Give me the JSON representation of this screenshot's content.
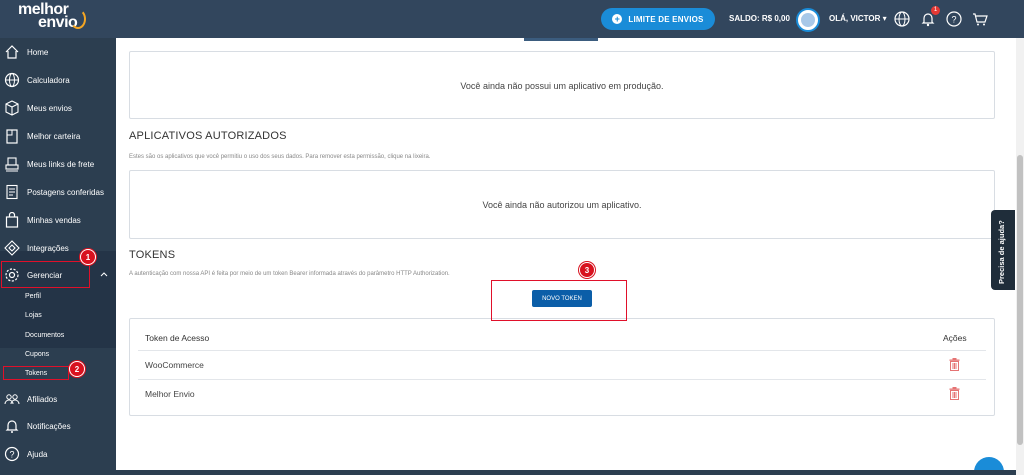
{
  "header": {
    "logo_line1": "melhor",
    "logo_line2": "envio",
    "limit_button": "LIMITE DE ENVIOS",
    "saldo": "SALDO: R$ 0,00",
    "greeting": "OLÁ, VICTOR",
    "notification_count": "1"
  },
  "sidebar": {
    "items": [
      {
        "label": "Home",
        "icon": "home-icon"
      },
      {
        "label": "Calculadora",
        "icon": "globe-icon"
      },
      {
        "label": "Meus envios",
        "icon": "box-icon"
      },
      {
        "label": "Melhor carteira",
        "icon": "wallet-icon"
      },
      {
        "label": "Meus links de frete",
        "icon": "truck-icon"
      },
      {
        "label": "Postagens conferidas",
        "icon": "receipt-icon"
      },
      {
        "label": "Minhas vendas",
        "icon": "bag-icon"
      },
      {
        "label": "Integrações",
        "icon": "puzzle-icon"
      },
      {
        "label": "Gerenciar",
        "icon": "gear-icon"
      },
      {
        "label": "Afiliados",
        "icon": "users-icon"
      },
      {
        "label": "Notificações",
        "icon": "bell-icon"
      },
      {
        "label": "Ajuda",
        "icon": "help-icon"
      }
    ],
    "subitems": [
      "Perfil",
      "Lojas",
      "Documentos",
      "Cupons",
      "Tokens"
    ]
  },
  "main": {
    "production_empty": "Você ainda não possui um aplicativo em produção.",
    "authorized_title": "APLICATIVOS AUTORIZADOS",
    "authorized_desc": "Estes são os aplicativos que você permitiu o uso dos seus dados. Para remover esta permissão, clique na lixeira.",
    "authorized_empty": "Você ainda não autorizou um aplicativo.",
    "tokens_title": "TOKENS",
    "tokens_desc": "A autenticação com nossa API é feita por meio de um token Bearer informada através do parâmetro HTTP Authorization.",
    "new_token_button": "NOVO TOKEN",
    "table": {
      "headers": [
        "Token de Acesso",
        "Ações"
      ],
      "rows": [
        {
          "name": "WooCommerce"
        },
        {
          "name": "Melhor Envio"
        }
      ]
    }
  },
  "annotations": [
    "1",
    "2",
    "3"
  ],
  "help_tab": "Precisa de ajuda?",
  "colors": {
    "topbar": "#32465d",
    "sidebar": "#2c3e50",
    "accent": "#1a8cd8",
    "primary_button": "#0b5ea8",
    "annotation": "#e0102a",
    "trash": "#e57373"
  }
}
